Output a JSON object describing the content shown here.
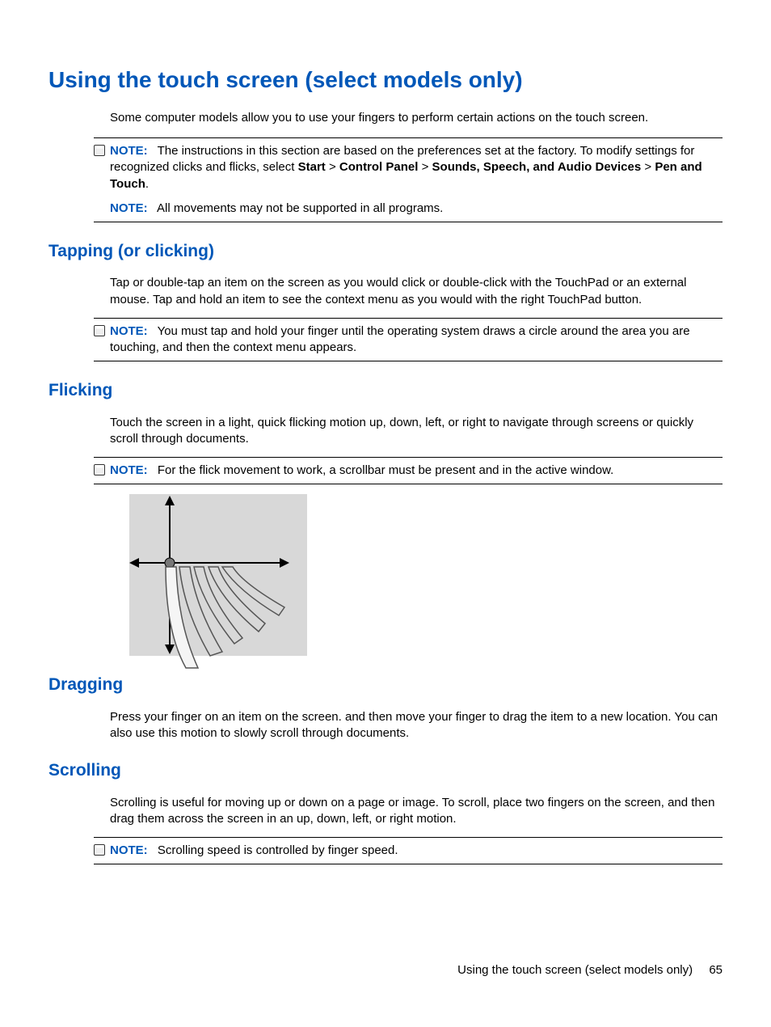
{
  "title": "Using the touch screen (select models only)",
  "intro": "Some computer models allow you to use your fingers to perform certain actions on the touch screen.",
  "note1": {
    "label": "NOTE:",
    "pre": "The instructions in this section are based on the preferences set at the factory. To modify settings for recognized clicks and flicks, select ",
    "s1": "Start",
    "g": " > ",
    "s2": "Control Panel",
    "s3": "Sounds, Speech, and Audio Devices",
    "s4": "Pen and Touch",
    "dot": "."
  },
  "note2": {
    "label": "NOTE:",
    "text": "All movements may not be supported in all programs."
  },
  "tapping": {
    "heading": "Tapping (or clicking)",
    "text": "Tap or double-tap an item on the screen as you would click or double-click with the TouchPad or an external mouse. Tap and hold an item to see the context menu as you would with the right TouchPad button."
  },
  "note3": {
    "label": "NOTE:",
    "text": "You must tap and hold your finger until the operating system draws a circle around the area you are touching, and then the context menu appears."
  },
  "flicking": {
    "heading": "Flicking",
    "text": "Touch the screen in a light, quick flicking motion up, down, left, or right to navigate through screens or quickly scroll through documents."
  },
  "note4": {
    "label": "NOTE:",
    "text": "For the flick movement to work, a scrollbar must be present and in the active window."
  },
  "dragging": {
    "heading": "Dragging",
    "text": "Press your finger on an item on the screen. and then move your finger to drag the item to a new location. You can also use this motion to slowly scroll through documents."
  },
  "scrolling": {
    "heading": "Scrolling",
    "text": "Scrolling is useful for moving up or down on a page or image. To scroll, place two fingers on the screen, and then drag them across the screen in an up, down, left, or right motion."
  },
  "note5": {
    "label": "NOTE:",
    "text": "Scrolling speed is controlled by finger speed."
  },
  "footer": {
    "text": "Using the touch screen (select models only)",
    "page": "65"
  }
}
